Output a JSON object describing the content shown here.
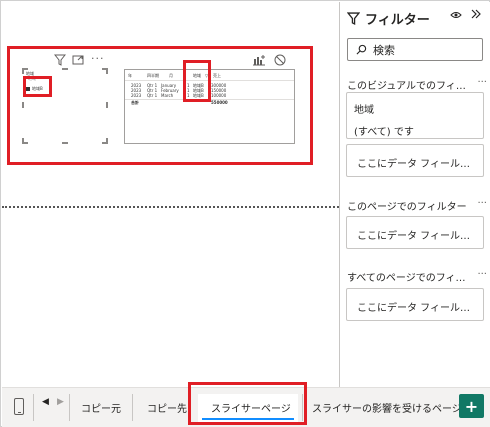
{
  "visual_header": {
    "filter_icon": "filter-icon",
    "focus_icon": "focus-mode-icon",
    "more_label": "···",
    "analytics_icon": "analytics-icon",
    "disable_icon": "disable-icon"
  },
  "slicer": {
    "title": "地域",
    "item_top": "地域",
    "item": "地域B"
  },
  "table": {
    "headers": [
      "年",
      "四半期",
      "月",
      "地域",
      "▽",
      "売上"
    ],
    "rows": [
      [
        "2023",
        "Qtr 1",
        "January",
        "1",
        "地域B",
        "300000"
      ],
      [
        "2023",
        "Qtr 1",
        "February",
        "1",
        "地域B",
        "150000"
      ],
      [
        "2023",
        "Qtr 1",
        "March",
        "1",
        "地域B",
        "100000"
      ]
    ],
    "total_label": "合計",
    "total_value": "550000"
  },
  "pane": {
    "title": "フィルター",
    "search_placeholder": "検索",
    "visual_section": "このビジュアルでのフィルター...",
    "region_field": "地域",
    "region_value": "(すべて) です",
    "add_field_1": "ここにデータ フィールド...",
    "page_section": "このページでのフィルター",
    "add_field_2": "ここにデータ フィールド...",
    "all_pages_section": "すべてのページでのフィルター...",
    "add_field_3": "ここにデータ フィールド...",
    "dots": "···"
  },
  "tabs": {
    "copy_src": "コピー元",
    "copy_dst": "コピー先",
    "slicer_page": "スライサーページ",
    "affected_page": "スライサーの影響を受けるページ",
    "add_label": "+"
  },
  "colors": {
    "highlight": "#e01e25",
    "accent": "#118dff",
    "add_button": "#117865"
  }
}
